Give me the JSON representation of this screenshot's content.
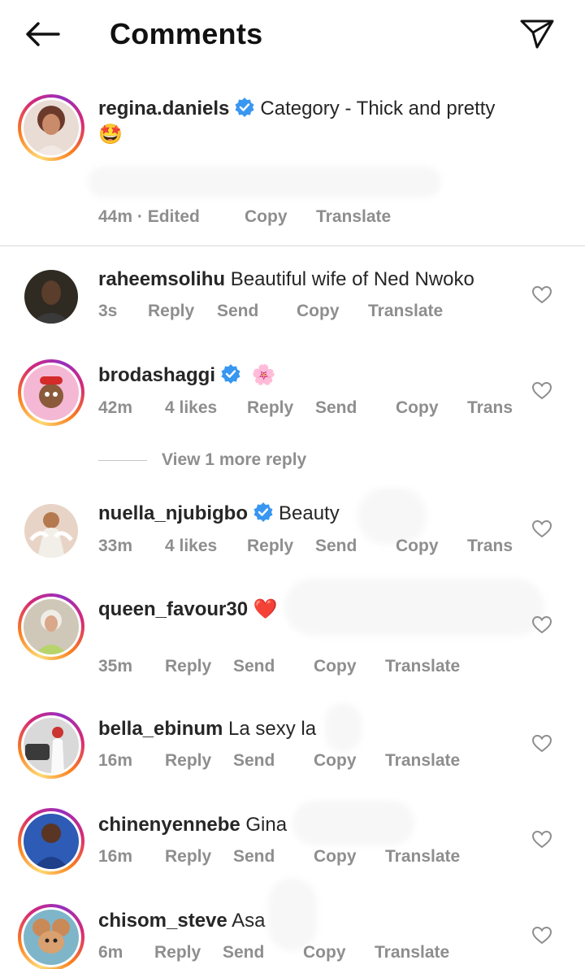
{
  "header": {
    "title": "Comments",
    "back_icon": "arrow-left-icon",
    "send_icon": "paper-plane-icon"
  },
  "caption": {
    "username": "regina.daniels",
    "verified": true,
    "text": "Category - Thick and pretty",
    "emoji": "🤩",
    "time": "44m · Edited",
    "copy": "Copy",
    "translate": "Translate"
  },
  "comments": [
    {
      "username": "raheemsolihu",
      "verified": false,
      "text": "Beautiful wife of Ned Nwoko",
      "time": "3s",
      "likes": "",
      "reply": "Reply",
      "send": "Send",
      "copy": "Copy",
      "translate": "Translate"
    },
    {
      "username": "brodashaggi",
      "verified": true,
      "text": "🌸",
      "time": "42m",
      "likes": "4 likes",
      "reply": "Reply",
      "send": "Send",
      "copy": "Copy",
      "translate": "Trans"
    },
    {
      "username": "nuella_njubigbo",
      "verified": true,
      "text": "Beauty",
      "time": "33m",
      "likes": "4 likes",
      "reply": "Reply",
      "send": "Send",
      "copy": "Copy",
      "translate": "Trans"
    },
    {
      "username": "queen_favour30",
      "verified": false,
      "text": "❤️",
      "time": "35m",
      "likes": "",
      "reply": "Reply",
      "send": "Send",
      "copy": "Copy",
      "translate": "Translate"
    },
    {
      "username": "bella_ebinum",
      "verified": false,
      "text": "La sexy la",
      "time": "16m",
      "likes": "",
      "reply": "Reply",
      "send": "Send",
      "copy": "Copy",
      "translate": "Translate"
    },
    {
      "username": "chinenyennebe",
      "verified": false,
      "text": "Gina",
      "time": "16m",
      "likes": "",
      "reply": "Reply",
      "send": "Send",
      "copy": "Copy",
      "translate": "Translate"
    },
    {
      "username": "chisom_steve",
      "verified": false,
      "text": "Asa",
      "time": "6m",
      "likes": "",
      "reply": "Reply",
      "send": "Send",
      "copy": "Copy",
      "translate": "Translate"
    }
  ],
  "view_more_replies": "View 1 more reply",
  "colors": {
    "verified": "#3897f0",
    "muted": "#8e8e8e",
    "text": "#262626",
    "heart": "#8e8e8e"
  }
}
